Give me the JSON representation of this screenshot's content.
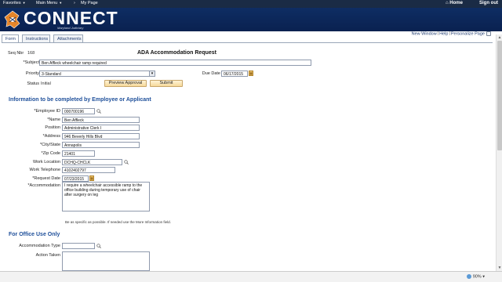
{
  "topnav": {
    "favorites": "Favorites",
    "main_menu": "Main Menu",
    "my_page": "My Page",
    "home": "Home",
    "sign_out": "Sign out"
  },
  "banner": {
    "brand": "CONNECT",
    "subtitle": "Maryland Judiciary"
  },
  "tabs": [
    "Form",
    "Instructions",
    "Attachments"
  ],
  "toplinks": [
    "New Window",
    "Help",
    "Personalize Page"
  ],
  "form": {
    "seq_label": "Seq Nbr",
    "seq_value": "168",
    "title": "ADA Accommodation Request",
    "subject_label": "*Subject",
    "subject_value": "Ben Affleck wheelchair ramp required",
    "priority_label": "Priority",
    "priority_value": "3-Standard",
    "due_date_label": "Due Date",
    "due_date_value": "06/17/2015",
    "status_label": "Status",
    "status_value": "Initial",
    "preview_button": "Preview Approval",
    "submit_button": "Submit"
  },
  "employee_section": {
    "heading": "Information to be completed by Employee or Applicant",
    "employee_id_label": "*Employee ID",
    "employee_id_value": "000700196",
    "name_label": "*Name",
    "name_value": "Ben Affleck",
    "position_label": "Position",
    "position_value": "Administrative Clerk I",
    "address_label": "*Address",
    "address_value": "946 Beverly Hills Blvd",
    "city_label": "*City/State",
    "city_value": "Annapolis",
    "zip_label": "*Zip Code",
    "zip_value": "21401",
    "work_location_label": "Work Location",
    "work_location_value": "DCHQ-CHCLK",
    "work_phone_label": "Work Telephone",
    "work_phone_value": "4102402797",
    "request_date_label": "*Request Date",
    "request_date_value": "07/23/2015",
    "accommodation_label": "*Accommodation",
    "accommodation_value": "I require a wheelchair accessible ramp to the office building during temporary use of chair after surgery on leg",
    "hint": "Be as specific as possible. If needed use the More Information field."
  },
  "office_section": {
    "heading": "For Office Use Only",
    "accommodation_type_label": "Accommodation Type",
    "accommodation_type_value": "",
    "action_taken_label": "Action Taken",
    "action_taken_value": ""
  },
  "statusbar": {
    "zoom": "90%"
  },
  "colors": {
    "topnav_bg": "#1a2b45",
    "banner_bg": "#0e2d63",
    "section_heading": "#1e4f9a",
    "button_bg": "#f6d99a"
  }
}
